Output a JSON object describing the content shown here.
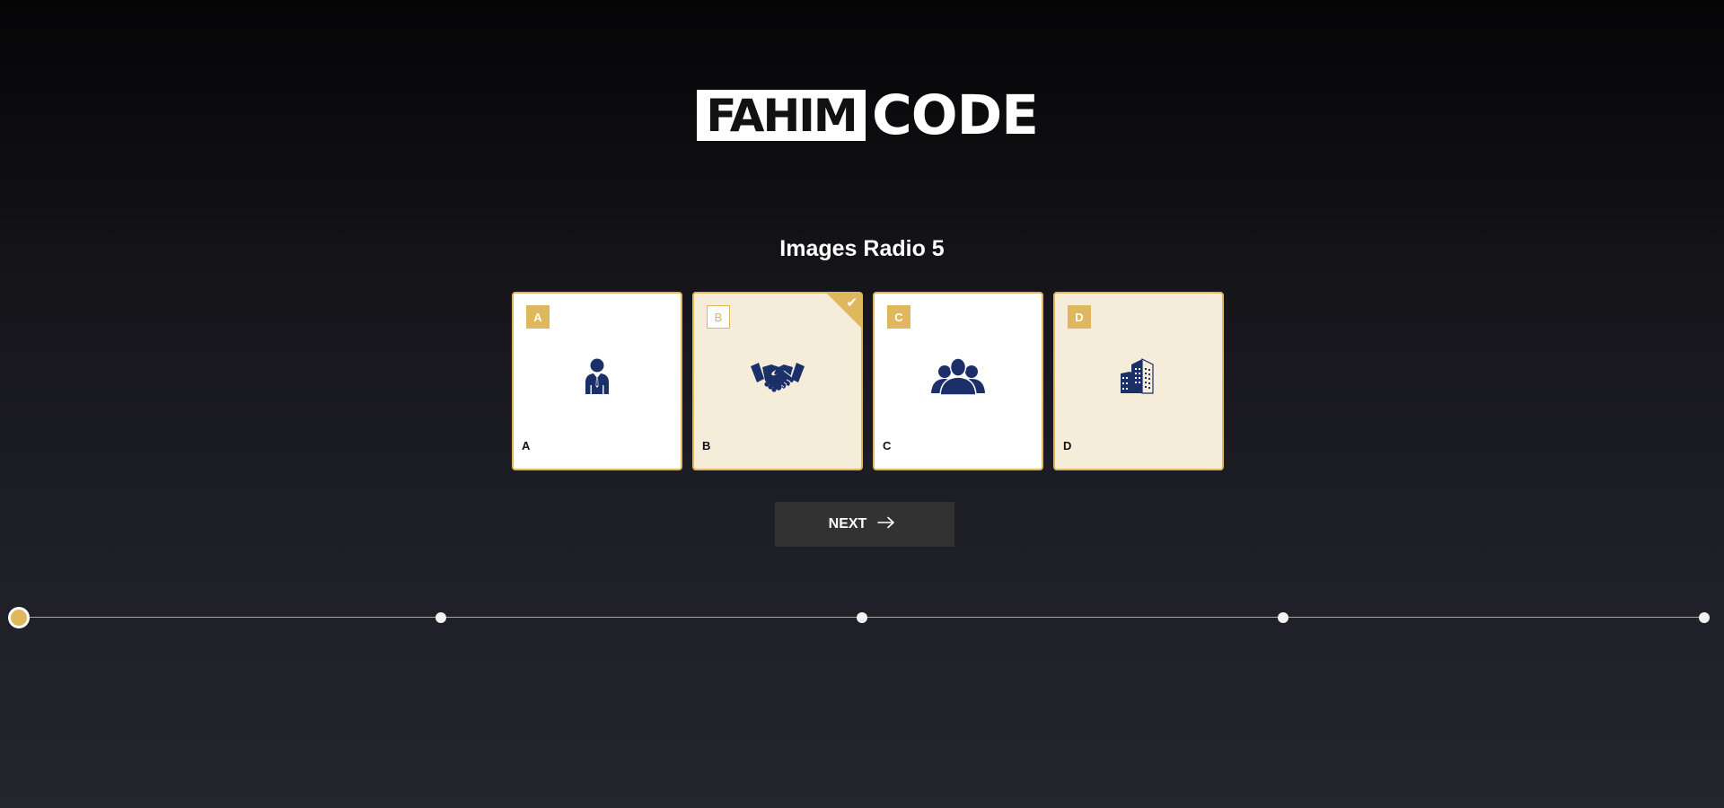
{
  "logo": {
    "boxed_text": "FAHIM",
    "text": "CODE"
  },
  "question": {
    "title": "Images Radio 5"
  },
  "options": [
    {
      "key": "A",
      "label": "A",
      "icon": "businessman-icon",
      "selected": false
    },
    {
      "key": "B",
      "label": "B",
      "icon": "handshake-icon",
      "selected": true
    },
    {
      "key": "C",
      "label": "C",
      "icon": "group-icon",
      "selected": false
    },
    {
      "key": "D",
      "label": "D",
      "icon": "buildings-icon",
      "selected": false
    }
  ],
  "selected_check_icon": "checkmark-icon",
  "next_button": {
    "label": "NEXT",
    "icon": "arrow-right-icon"
  },
  "progress": {
    "steps": 5,
    "current_step": 1
  },
  "colors": {
    "accent": "#dfb75c",
    "card_selected_bg": "#f6ecda",
    "icon_navy": "#1b2f68",
    "button_bg": "#323232"
  }
}
